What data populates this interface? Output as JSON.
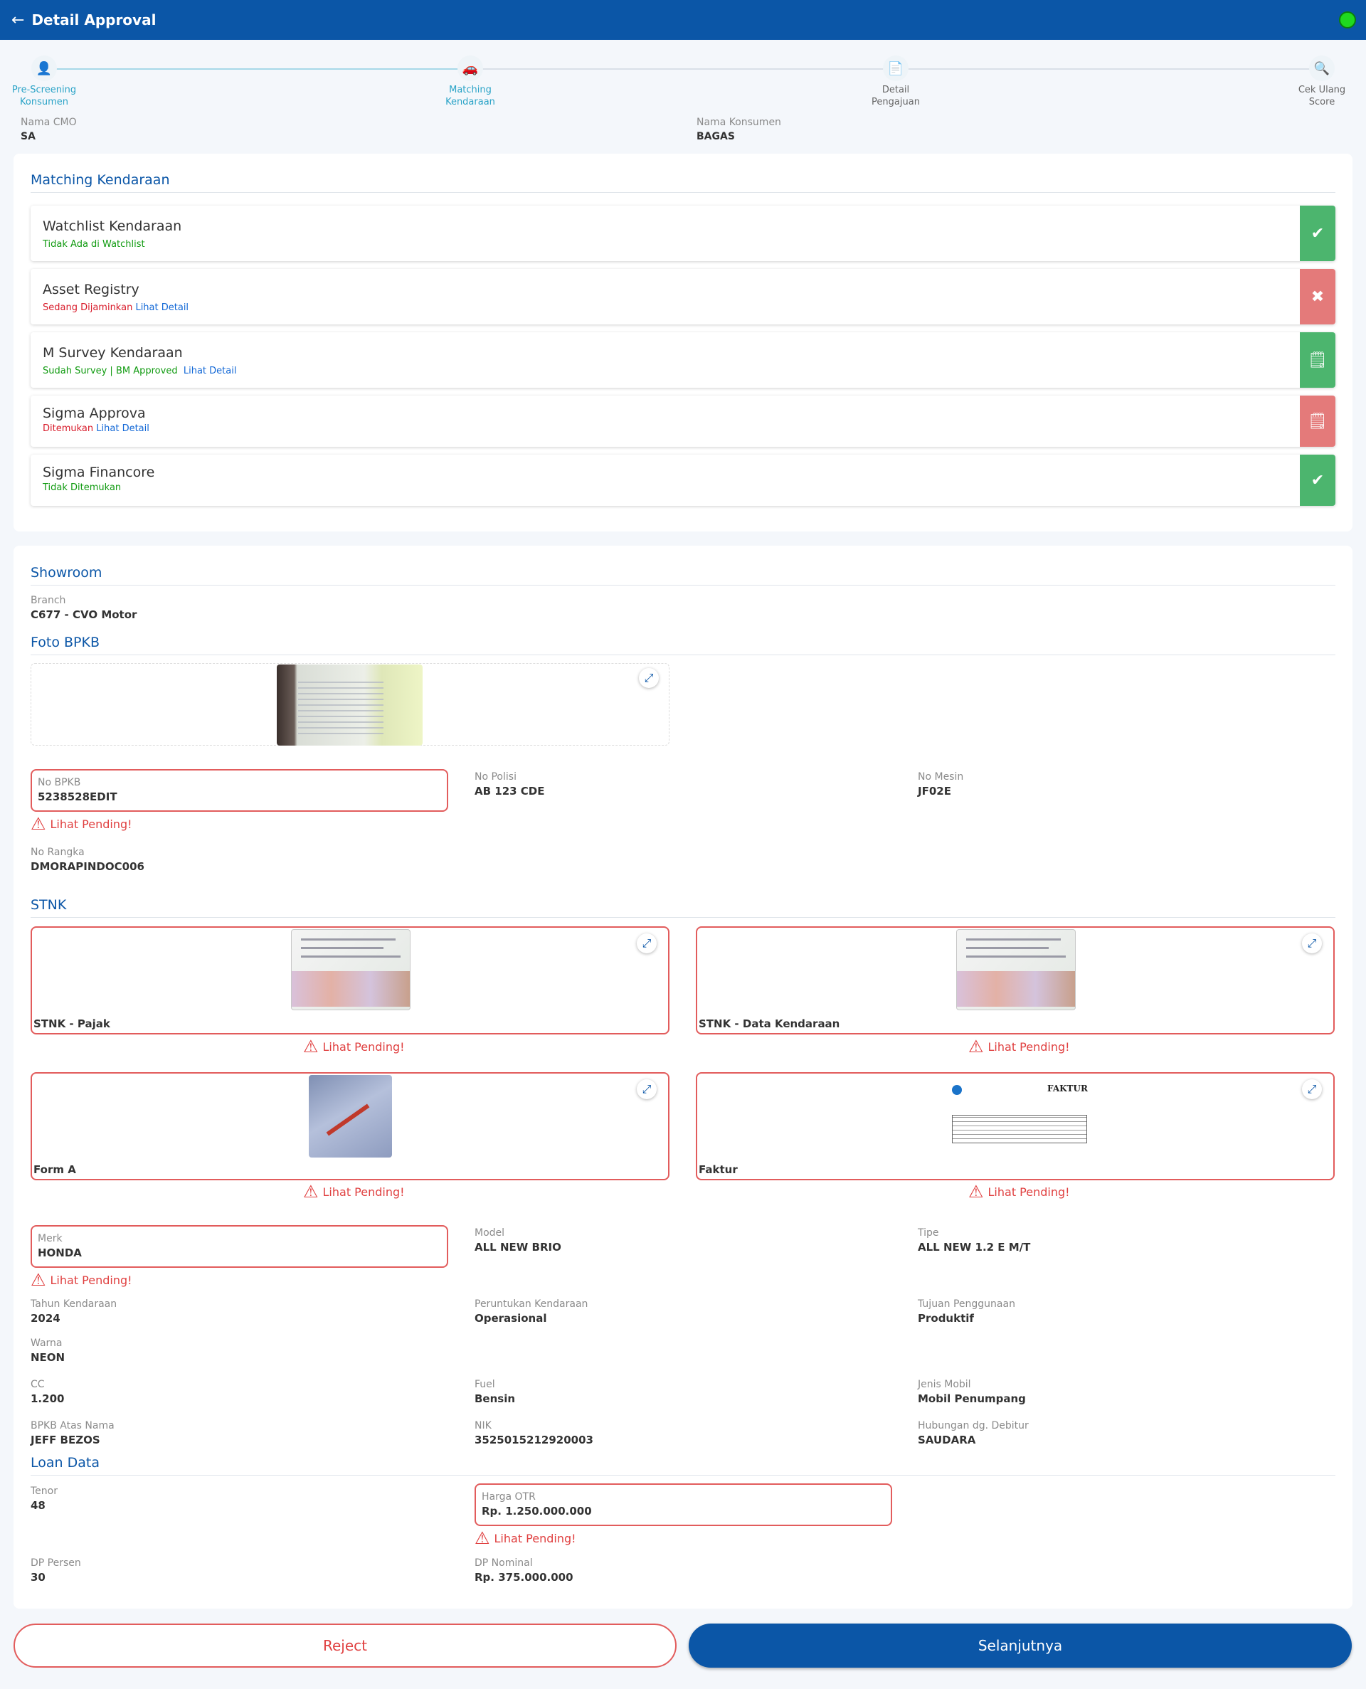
{
  "header": {
    "title": "Detail Approval"
  },
  "steps": [
    {
      "line1": "Pre-Screening",
      "line2": "Konsumen"
    },
    {
      "line1": "Matching",
      "line2": "Kendaraan"
    },
    {
      "line1": "Detail",
      "line2": "Pengajuan"
    },
    {
      "line1": "Cek Ulang",
      "line2": "Score"
    }
  ],
  "meta": {
    "cmo_label": "Nama CMO",
    "cmo_value": "SA",
    "konsumen_label": "Nama Konsumen",
    "konsumen_value": "BAGAS"
  },
  "matching": {
    "title": "Matching Kendaraan",
    "rows": [
      {
        "title": "Watchlist Kendaraan",
        "status": "Tidak Ada di Watchlist",
        "link": ""
      },
      {
        "title": "Asset Registry",
        "status": "Sedang Dijaminkan",
        "link": "Lihat Detail"
      },
      {
        "title": "M Survey Kendaraan",
        "status": "Sudah Survey | BM Approved",
        "link": "Lihat Detail"
      },
      {
        "title": "Sigma Approva",
        "status": "Ditemukan",
        "link": "Lihat Detail"
      },
      {
        "title": "Sigma Financore",
        "status": "Tidak Ditemukan",
        "link": ""
      }
    ]
  },
  "showroom": {
    "title": "Showroom",
    "branch_label": "Branch",
    "branch_value": "C677 - CVO Motor"
  },
  "bpkb": {
    "title": "Foto BPKB",
    "no_bpkb_label": "No BPKB",
    "no_bpkb_value": "5238528EDIT",
    "no_polisi_label": "No Polisi",
    "no_polisi_value": "AB 123 CDE",
    "no_mesin_label": "No Mesin",
    "no_mesin_value": "JF02E",
    "no_rangka_label": "No Rangka",
    "no_rangka_value": "DMORAPINDOC006"
  },
  "pending_text": "Lihat Pending!",
  "stnk": {
    "title": "STNK",
    "docs": [
      "STNK - Pajak",
      "STNK - Data Kendaraan",
      "Form A",
      "Faktur"
    ],
    "faktur_heading": "FAKTUR"
  },
  "vehicle": {
    "merk_label": "Merk",
    "merk_value": "HONDA",
    "model_label": "Model",
    "model_value": "ALL NEW BRIO",
    "tipe_label": "Tipe",
    "tipe_value": "ALL NEW 1.2 E M/T",
    "tahun_label": "Tahun Kendaraan",
    "tahun_value": "2024",
    "peruntukan_label": "Peruntukan Kendaraan",
    "peruntukan_value": "Operasional",
    "tujuan_label": "Tujuan Penggunaan",
    "tujuan_value": "Produktif",
    "warna_label": "Warna",
    "warna_value": "NEON",
    "cc_label": "CC",
    "cc_value": "1.200",
    "fuel_label": "Fuel",
    "fuel_value": "Bensin",
    "jenis_label": "Jenis Mobil",
    "jenis_value": "Mobil Penumpang",
    "atas_nama_label": "BPKB Atas Nama",
    "atas_nama_value": "JEFF BEZOS",
    "nik_label": "NIK",
    "nik_value": "3525015212920003",
    "hubungan_label": "Hubungan dg. Debitur",
    "hubungan_value": "SAUDARA"
  },
  "loan": {
    "title": "Loan Data",
    "tenor_label": "Tenor",
    "tenor_value": "48",
    "otr_label": "Harga OTR",
    "otr_value": "Rp. 1.250.000.000",
    "dp_persen_label": "DP Persen",
    "dp_persen_value": "30",
    "dp_nominal_label": "DP Nominal",
    "dp_nominal_value": "Rp. 375.000.000"
  },
  "actions": {
    "reject": "Reject",
    "next": "Selanjutnya"
  },
  "colors": {
    "primary": "#0b56a7",
    "pending": "#e25c5c",
    "ok": "#4cb56e",
    "fail": "#e47a7a"
  }
}
